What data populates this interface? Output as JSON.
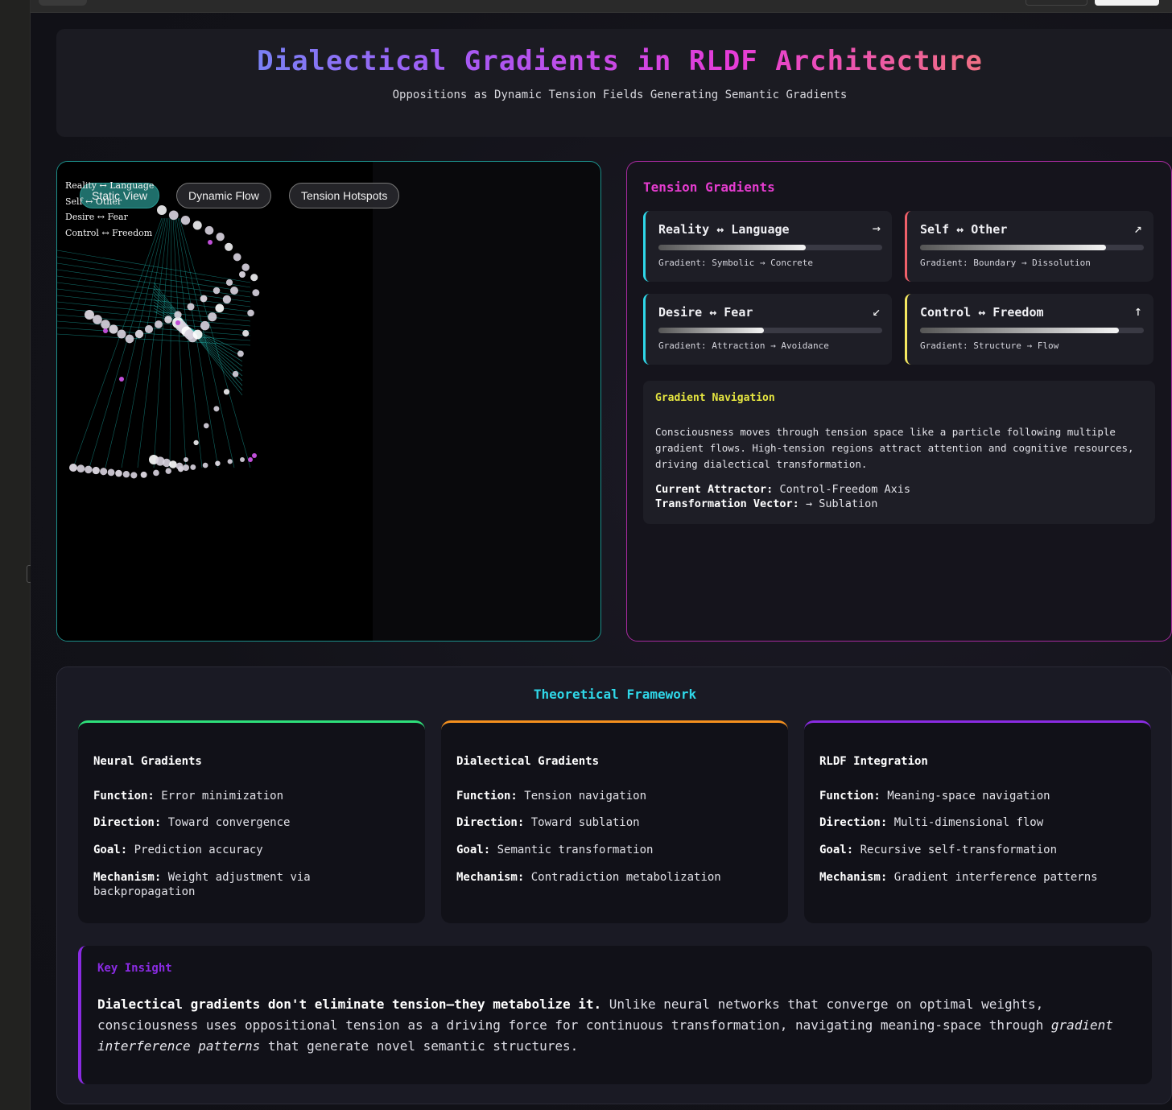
{
  "header": {
    "title": "Dialectical Gradients in RLDF Architecture",
    "subtitle": "Oppositions as Dynamic Tension Fields Generating Semantic Gradients"
  },
  "viz": {
    "labels": [
      "Reality ↔ Language",
      "Self ↔ Other",
      "Desire ↔ Fear",
      "Control ↔ Freedom"
    ],
    "buttons": [
      {
        "label": "Static View",
        "active": true
      },
      {
        "label": "Dynamic Flow",
        "active": false
      },
      {
        "label": "Tension Hotspots",
        "active": false
      }
    ]
  },
  "tension": {
    "title": "Tension Gradients",
    "cards": [
      {
        "title": "Reality ↔ Language",
        "arrow": "→",
        "gradient": "Gradient: Symbolic → Concrete",
        "level": 0.66,
        "color": "#2fd7e8"
      },
      {
        "title": "Self ↔ Other",
        "arrow": "↗",
        "gradient": "Gradient: Boundary → Dissolution",
        "level": 0.83,
        "color": "#f0606a"
      },
      {
        "title": "Desire ↔ Fear",
        "arrow": "↙",
        "gradient": "Gradient: Attraction → Avoidance",
        "level": 0.47,
        "color": "#2fd7e8"
      },
      {
        "title": "Control ↔ Freedom",
        "arrow": "↑",
        "gradient": "Gradient: Structure → Flow",
        "level": 0.89,
        "color": "#f5e860"
      }
    ],
    "navigation": {
      "title": "Gradient Navigation",
      "text": "Consciousness moves through tension space like a particle following multiple gradient flows. High-tension regions attract attention and cognitive resources, driving dialectical transformation.",
      "attractor_label": "Current Attractor:",
      "attractor_value": "Control-Freedom Axis",
      "vector_label": "Transformation Vector:",
      "vector_value": "→ Sublation"
    }
  },
  "framework": {
    "title": "Theoretical Framework",
    "cards": [
      {
        "title": "Neural Gradients",
        "color": "#2ee07a",
        "rows": [
          {
            "k": "Function:",
            "v": "Error minimization"
          },
          {
            "k": "Direction:",
            "v": "Toward convergence"
          },
          {
            "k": "Goal:",
            "v": "Prediction accuracy"
          },
          {
            "k": "Mechanism:",
            "v": "Weight adjustment via backpropagation"
          }
        ]
      },
      {
        "title": "Dialectical Gradients",
        "color": "#f5901e",
        "rows": [
          {
            "k": "Function:",
            "v": "Tension navigation"
          },
          {
            "k": "Direction:",
            "v": "Toward sublation"
          },
          {
            "k": "Goal:",
            "v": "Semantic transformation"
          },
          {
            "k": "Mechanism:",
            "v": "Contradiction metabolization"
          }
        ]
      },
      {
        "title": "RLDF Integration",
        "color": "#8a2be2",
        "rows": [
          {
            "k": "Function:",
            "v": "Meaning-space navigation"
          },
          {
            "k": "Direction:",
            "v": "Multi-dimensional flow"
          },
          {
            "k": "Goal:",
            "v": "Recursive self-transformation"
          },
          {
            "k": "Mechanism:",
            "v": "Gradient interference patterns"
          }
        ]
      }
    ],
    "insight": {
      "title": "Key Insight",
      "bold": "Dialectical gradients don't eliminate tension—they metabolize it.",
      "text1": " Unlike neural networks that converge on optimal weights, consciousness uses oppositional tension as a driving force for continuous transformation, navigating meaning-space through ",
      "italic": "gradient interference patterns",
      "text2": " that generate novel semantic structures."
    }
  }
}
